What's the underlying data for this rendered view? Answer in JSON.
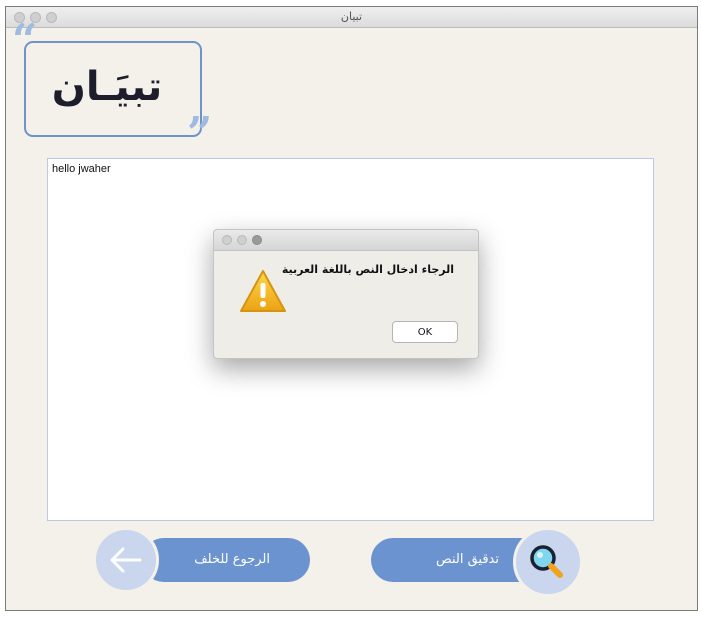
{
  "window": {
    "title": "تبيان"
  },
  "logo": {
    "text": "تبيَـان",
    "open_quote": "“",
    "close_quote": "”"
  },
  "editor": {
    "content": "hello jwaher"
  },
  "alert": {
    "message": "الرجاء ادخال النص باللغة العربية",
    "ok_label": "OK",
    "icon": "warning-icon"
  },
  "buttons": {
    "back_label": "الرجوع للخلف",
    "back_icon": "arrow-left-icon",
    "check_label": "تدقيق النص",
    "check_icon": "magnifier-icon"
  },
  "colors": {
    "accent": "#6b93cf",
    "accent_light": "#c9d6ee",
    "background": "#f4f1eb",
    "warning": "#f2b51c"
  }
}
